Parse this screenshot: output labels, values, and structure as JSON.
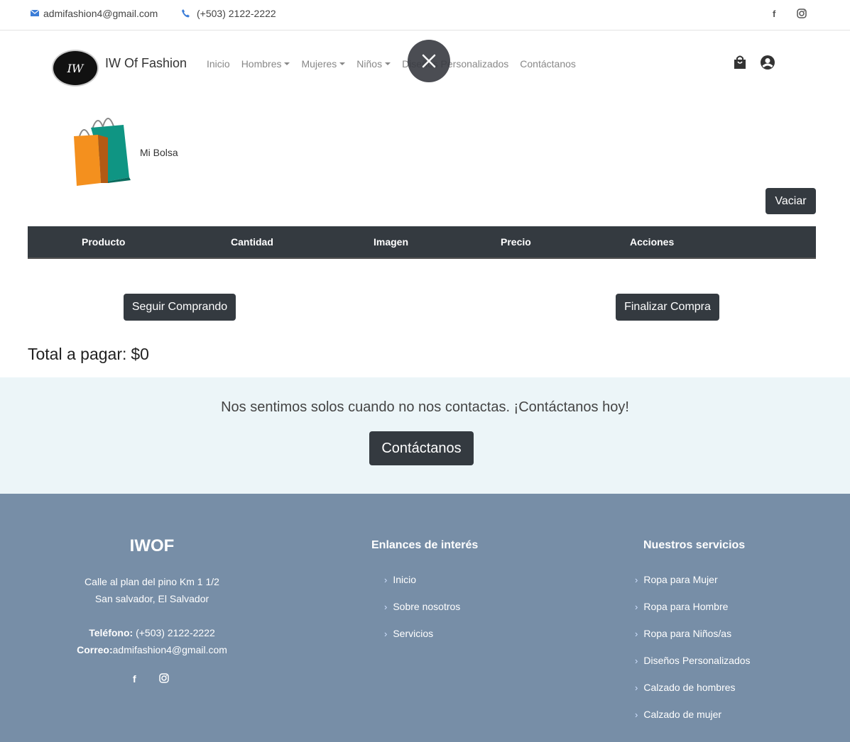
{
  "topbar": {
    "email": "admifashion4@gmail.com",
    "phone": "(+503) 2122-2222",
    "facebook_glyph": "f",
    "instagram_glyph": "◎"
  },
  "navbar": {
    "logo_text": "IW",
    "brand": "IW Of Fashion",
    "links": [
      {
        "label": "Inicio",
        "dropdown": false
      },
      {
        "label": "Hombres",
        "dropdown": true
      },
      {
        "label": "Mujeres",
        "dropdown": true
      },
      {
        "label": "Niños",
        "dropdown": true
      },
      {
        "label": "Diseños Personalizados",
        "dropdown": false
      },
      {
        "label": "Contáctanos",
        "dropdown": false
      }
    ],
    "icons": [
      "shopping-bag-icon",
      "user-circle-icon"
    ]
  },
  "overlay": {
    "close_glyph": "✕"
  },
  "cart": {
    "title": "Mi Bolsa",
    "empty_button": "Vaciar",
    "columns": [
      "Producto",
      "Cantidad",
      "Imagen",
      "Precio",
      "Acciones"
    ],
    "continue_button": "Seguir Comprando",
    "checkout_button": "Finalizar Compra",
    "total_label": "Total a pagar:",
    "total_value": "$0"
  },
  "contact_band": {
    "text": "Nos sentimos solos cuando no nos contactas. ¡Contáctanos hoy!",
    "button": "Contáctanos"
  },
  "footer": {
    "brand": "IWOF",
    "address_line1": "Calle al plan del pino Km 1 1/2",
    "address_line2": "San salvador, El Salvador",
    "phone_label": "Teléfono:",
    "phone_value": "(+503) 2122-2222",
    "email_label": "Correo:",
    "email_value": "admifashion4@gmail.com",
    "links_title": "Enlances de interés",
    "links": [
      "Inicio",
      "Sobre nosotros",
      "Servicios"
    ],
    "services_title": "Nuestros servicios",
    "services": [
      "Ropa para Mujer",
      "Ropa para Hombre",
      "Ropa para Niños/as",
      "Diseños Personalizados",
      "Calzado de hombres",
      "Calzado de mujer"
    ],
    "chevron_glyph": "›",
    "facebook_glyph": "f",
    "instagram_glyph": "◎"
  },
  "colors": {
    "dark": "#343a40",
    "band_bg": "#ecf5f8",
    "footer_bg": "#778ea7",
    "link_blue": "#3b7dd8"
  }
}
